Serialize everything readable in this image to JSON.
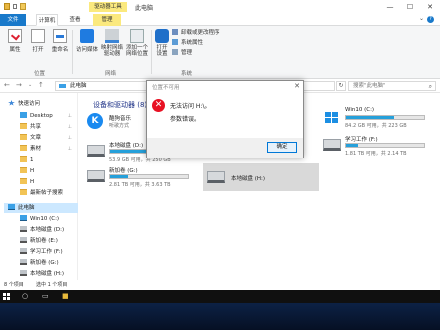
{
  "window": {
    "title": "此电脑",
    "drive_tools_label": "驱动器工具",
    "controls": {
      "minimize": "—",
      "maximize": "☐",
      "close": "✕"
    }
  },
  "tabs": [
    {
      "label": "文件"
    },
    {
      "label": "计算机"
    },
    {
      "label": "查看"
    },
    {
      "label": "管理"
    }
  ],
  "help": "?",
  "ribbon": {
    "location_group": {
      "label": "位置",
      "buttons": [
        {
          "label": "属性"
        },
        {
          "label": "打开"
        },
        {
          "label": "重命名"
        }
      ]
    },
    "network_group": {
      "label": "网络",
      "buttons": [
        {
          "label": "访问媒体"
        },
        {
          "label": "映射网络驱动器"
        },
        {
          "label": "添加一个网络位置"
        }
      ]
    },
    "system_group": {
      "label": "系统",
      "big_button": "打开设置",
      "small_items": [
        {
          "label": "卸载或更改程序"
        },
        {
          "label": "系统属性"
        },
        {
          "label": "管理"
        }
      ]
    }
  },
  "address": {
    "back": "←",
    "forward": "→",
    "up": "↑",
    "path": "此电脑",
    "refresh": "↻",
    "search_placeholder": "搜索\"此电脑\"",
    "search_icon": "⌕"
  },
  "sidebar": {
    "quick_access": "快速访问",
    "items": [
      {
        "label": "Desktop",
        "icon": "desk",
        "pin": "📌"
      },
      {
        "label": "共享",
        "icon": "folder",
        "pin": "📌"
      },
      {
        "label": "文章",
        "icon": "folder",
        "pin": "📌"
      },
      {
        "label": "素材",
        "icon": "folder",
        "pin": "📌"
      },
      {
        "label": "1",
        "icon": "folder"
      },
      {
        "label": "H",
        "icon": "folder"
      },
      {
        "label": "H",
        "icon": "folder"
      },
      {
        "label": "最新帖子搜索",
        "icon": "folder"
      }
    ],
    "this_pc": "此电脑",
    "drives": [
      {
        "label": "Win10 (C:)"
      },
      {
        "label": "本地磁盘 (D:)"
      },
      {
        "label": "新加卷 (E:)"
      },
      {
        "label": "学习工作 (F:)"
      },
      {
        "label": "新加卷 (G:)"
      },
      {
        "label": "本地磁盘 (H:)"
      }
    ]
  },
  "content": {
    "section_title": "设备和驱动器 (8)",
    "tiles": [
      {
        "name": "酷狗音乐",
        "info": "听歌方式",
        "kind": "kugou"
      },
      {
        "name": "本地磁盘 (D:)",
        "info": "53.9 GB 可用，共 250 GB",
        "fill": 0.78,
        "kind": "drive"
      },
      {
        "name": "新加卷 (G:)",
        "info": "2.81 TB 可用，共 3.63 TB",
        "fill": 0.23,
        "kind": "drive"
      },
      {
        "name": "Win10 (C:)",
        "info": "84.2 GB 可用，共 223 GB",
        "fill": 0.62,
        "kind": "win"
      },
      {
        "name": "学习工作 (F:)",
        "info": "1.81 TB 可用，共 2.14 TB",
        "fill": 0.15,
        "kind": "drive"
      },
      {
        "name": "本地磁盘 (H:)",
        "info": "",
        "kind": "drive"
      },
      {
        "name": "",
        "info": "",
        "kind": "drive"
      }
    ]
  },
  "status": {
    "count": "8 个项目",
    "selected": "选中 1 个项目"
  },
  "dialog": {
    "title": "位置不可用",
    "close": "✕",
    "icon_glyph": "✕",
    "message_line1": "无法访问 H:\\。",
    "message_line2": "参数错误。",
    "ok_label": "确定"
  },
  "colors": {
    "accent": "#1979ca",
    "drive_tools": "#fbe97e",
    "bar_fill": "#26a0da",
    "error": "#e81123"
  }
}
